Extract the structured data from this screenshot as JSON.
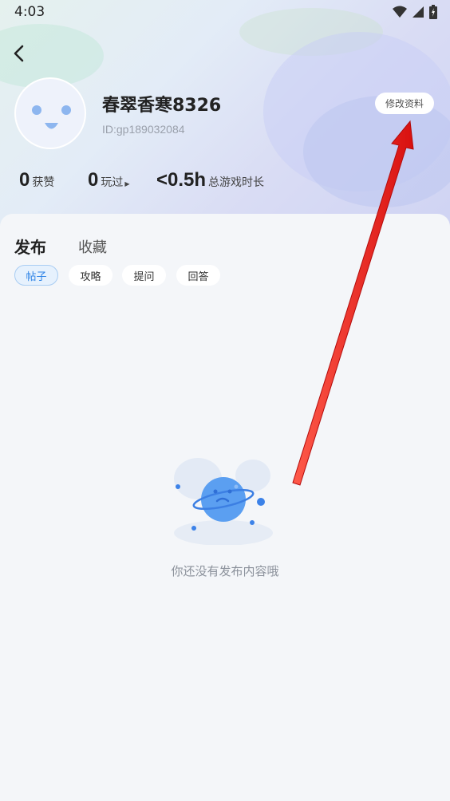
{
  "status_bar": {
    "time": "4:03"
  },
  "profile": {
    "username": "春翠香寒8326",
    "id_text": "ID:gp189032084",
    "edit_button": "修改资料"
  },
  "stats": [
    {
      "value": "0",
      "label": "获赞"
    },
    {
      "value": "0",
      "label": "玩过"
    },
    {
      "value": "<0.5h",
      "label": "总游戏时长"
    }
  ],
  "tabs": {
    "active": "发布",
    "other": "收藏"
  },
  "chips": [
    "帖子",
    "攻略",
    "提问",
    "回答"
  ],
  "empty_state": {
    "message": "你还没有发布内容哦"
  },
  "colors": {
    "accent": "#2e83e6",
    "annotation_arrow": "#e8201f"
  },
  "icons": [
    "back-icon",
    "wifi-icon",
    "signal-icon",
    "battery-icon"
  ]
}
